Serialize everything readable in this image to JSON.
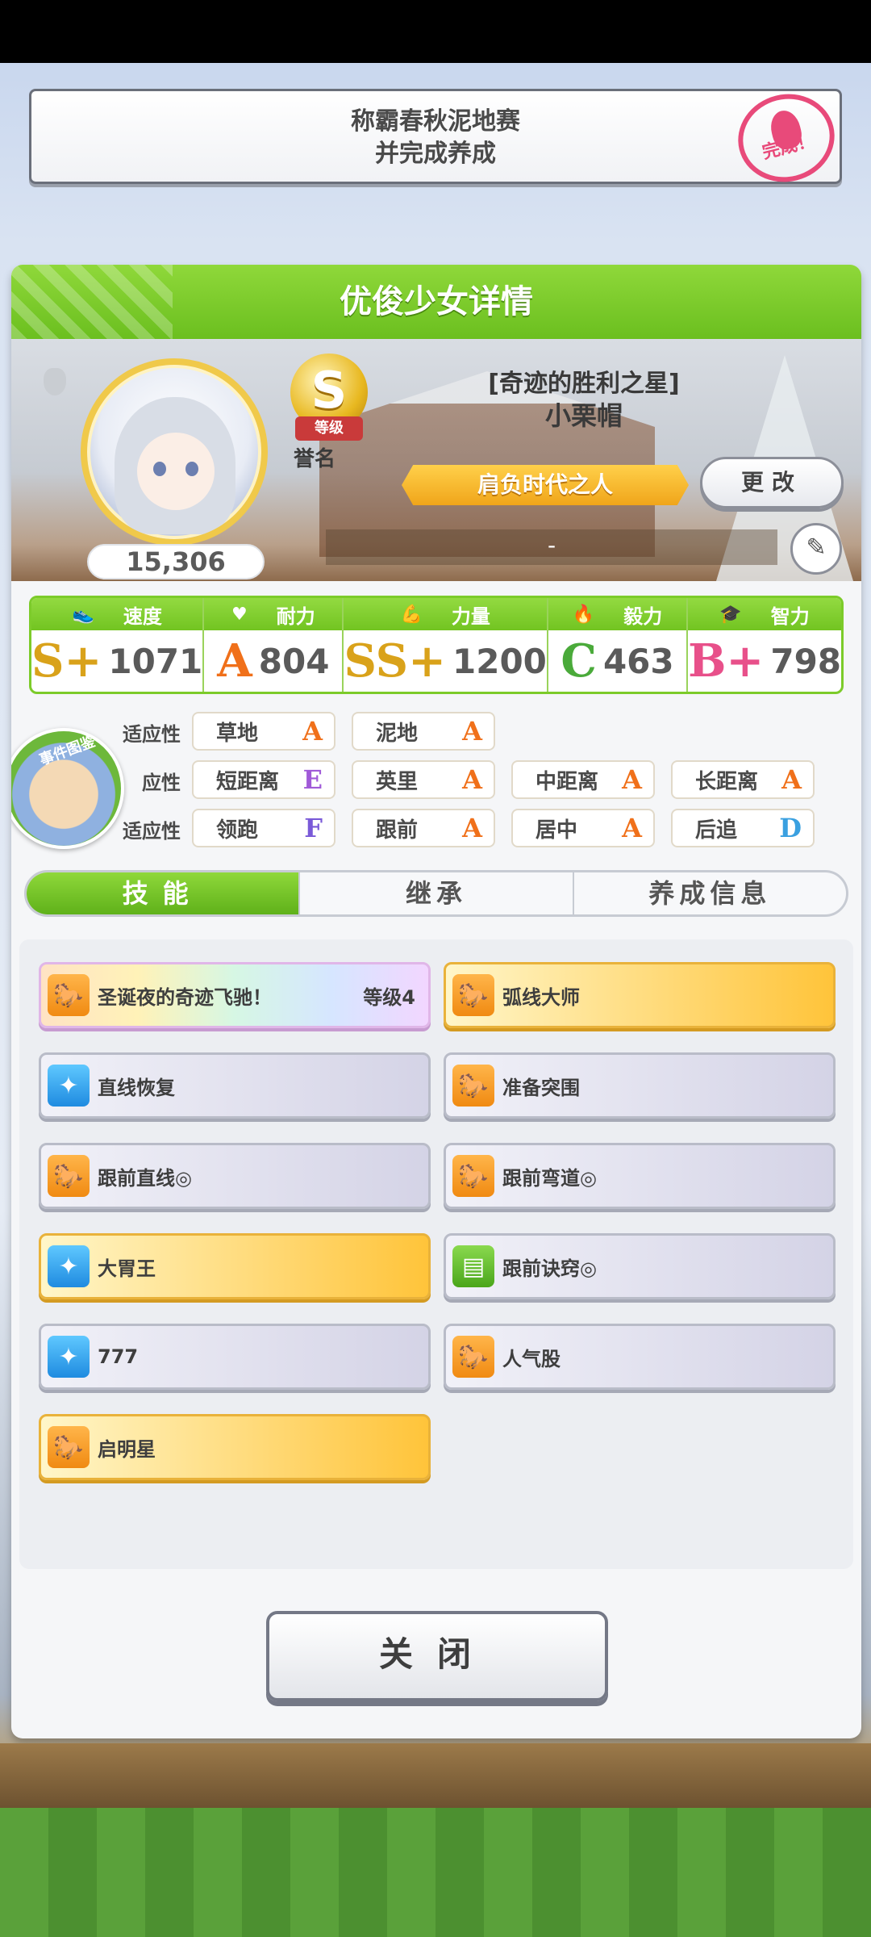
{
  "banner": {
    "line1": "称霸春秋泥地赛",
    "line2": "并完成养成",
    "stamp": "完成！"
  },
  "panel": {
    "title": "优俊少女详情"
  },
  "profile": {
    "fans": "15,306",
    "rank_letter": "S",
    "rank_label": "等级",
    "honor_label": "誉名",
    "epithet": "[奇迹的胜利之星]",
    "name": "小栗帽",
    "title": "肩负时代之人",
    "change_button": "更改",
    "subtitle": "-"
  },
  "stats": [
    {
      "label": "速度",
      "icon": "shoe-icon",
      "grade": "S+",
      "value": "1071",
      "color": "#d9a21a"
    },
    {
      "label": "耐力",
      "icon": "heart-icon",
      "grade": "A",
      "value": "804",
      "color": "#f0701a"
    },
    {
      "label": "力量",
      "icon": "muscle-icon",
      "grade": "SS+",
      "value": "1200",
      "color": "#d9a21a"
    },
    {
      "label": "毅力",
      "icon": "flame-icon",
      "grade": "C",
      "value": "463",
      "color": "#4aaa3a"
    },
    {
      "label": "智力",
      "icon": "graduation-cap-icon",
      "grade": "B+",
      "value": "798",
      "color": "#e8508a"
    }
  ],
  "aptitude": {
    "rows": [
      {
        "label": "适应性",
        "items": [
          {
            "name": "草地",
            "grade": "A"
          },
          {
            "name": "泥地",
            "grade": "A"
          }
        ]
      },
      {
        "label": "应性",
        "items": [
          {
            "name": "短距离",
            "grade": "E"
          },
          {
            "name": "英里",
            "grade": "A"
          },
          {
            "name": "中距离",
            "grade": "A"
          },
          {
            "name": "长距离",
            "grade": "A"
          }
        ]
      },
      {
        "label": "适应性",
        "items": [
          {
            "name": "领跑",
            "grade": "F"
          },
          {
            "name": "跟前",
            "grade": "A"
          },
          {
            "name": "居中",
            "grade": "A"
          },
          {
            "name": "后追",
            "grade": "D"
          }
        ]
      }
    ],
    "event_badge": "事件图鉴"
  },
  "tabs": [
    {
      "label": "技能",
      "active": true
    },
    {
      "label": "继承",
      "active": false
    },
    {
      "label": "养成信息",
      "active": false
    }
  ],
  "skills": [
    {
      "name": "圣诞夜的奇迹飞驰！",
      "level": "等级4",
      "style": "rainbow",
      "icon": "horse-icon"
    },
    {
      "name": "弧线大师",
      "level": "",
      "style": "gold",
      "icon": "horse-icon"
    },
    {
      "name": "直线恢复",
      "level": "",
      "style": "plain",
      "icon": "sparkle-icon"
    },
    {
      "name": "准备突围",
      "level": "",
      "style": "plain",
      "icon": "horse-icon"
    },
    {
      "name": "跟前直线◎",
      "level": "",
      "style": "plain",
      "icon": "horse-icon"
    },
    {
      "name": "跟前弯道◎",
      "level": "",
      "style": "plain",
      "icon": "horse-icon"
    },
    {
      "name": "大胃王",
      "level": "",
      "style": "gold",
      "icon": "sparkle-icon"
    },
    {
      "name": "跟前诀窍◎",
      "level": "",
      "style": "plain",
      "icon": "book-icon"
    },
    {
      "name": "777",
      "level": "",
      "style": "plain",
      "icon": "sparkle-icon"
    },
    {
      "name": "人气股",
      "level": "",
      "style": "plain",
      "icon": "horse-icon"
    },
    {
      "name": "启明星",
      "level": "",
      "style": "gold",
      "icon": "horse-icon"
    }
  ],
  "close_button": "关闭"
}
